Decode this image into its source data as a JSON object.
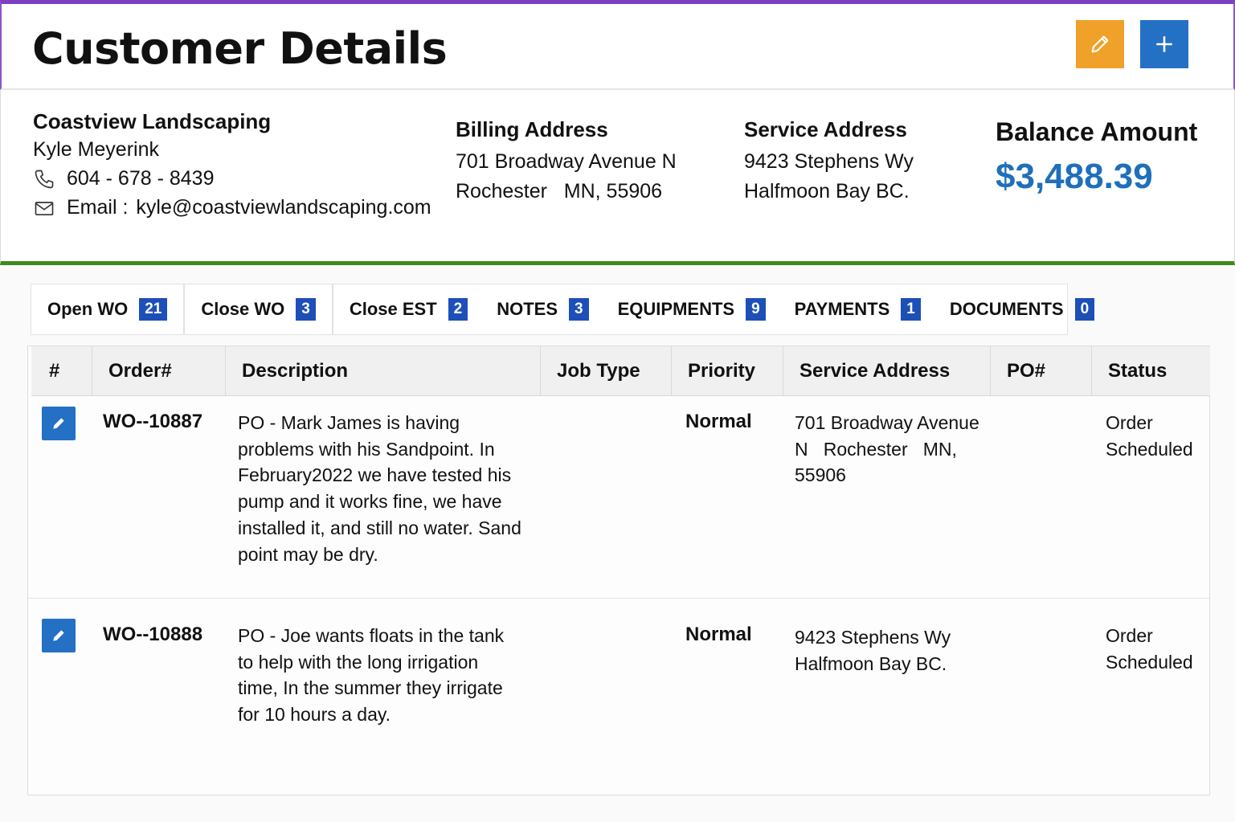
{
  "header": {
    "title": "Customer Details",
    "edit_icon": "pencil-icon",
    "add_icon": "plus-icon",
    "edit_color": "#f0a12a",
    "add_color": "#2470c4"
  },
  "customer": {
    "company": "Coastview Landscaping",
    "contact": "Kyle Meyerink",
    "phone": "604 - 678 - 8439",
    "email_label": "Email :",
    "email": "kyle@coastviewlandscaping.com"
  },
  "billing": {
    "label": "Billing Address",
    "line1": "701 Broadway Avenue N",
    "line2": "Rochester   MN, 55906"
  },
  "service": {
    "label": "Service Address",
    "line1": "9423 Stephens Wy",
    "line2": "Halfmoon Bay BC."
  },
  "balance": {
    "label": "Balance Amount",
    "amount": "$3,488.39",
    "color": "#1f6fba"
  },
  "tabs": [
    {
      "label": "Open WO",
      "count": "21"
    },
    {
      "label": "Close WO",
      "count": "3"
    },
    {
      "label": "Close EST",
      "count": "2"
    },
    {
      "label": "NOTES",
      "count": "3"
    },
    {
      "label": "EQUIPMENTS",
      "count": "9"
    },
    {
      "label": "PAYMENTS",
      "count": "1"
    },
    {
      "label": "DOCUMENTS",
      "count": "0"
    }
  ],
  "table": {
    "columns": [
      "#",
      "Order#",
      "Description",
      "Job Type",
      "Priority",
      "Service Address",
      "PO#",
      "Status"
    ],
    "rows": [
      {
        "order": "WO--10887",
        "description": "PO - Mark James is having problems with his Sandpoint. In February2022 we have tested his pump and it works fine, we have installed it, and still no water. Sand point may be dry.",
        "job_type": "",
        "priority": "Normal",
        "service_address": "701 Broadway Avenue N   Rochester   MN, 55906",
        "po": "",
        "status": "Order Scheduled"
      },
      {
        "order": "WO--10888",
        "description": "PO - Joe wants floats in the tank to help with the long irrigation time, In the summer they irrigate for 10 hours a day.",
        "job_type": "",
        "priority": "Normal",
        "service_address": "9423 Stephens Wy Halfmoon Bay BC.",
        "po": "",
        "status": "Order Scheduled"
      }
    ]
  },
  "colors": {
    "header_accent": "#7b3fc2",
    "divider": "#3e8a1e",
    "badge": "#1d4fb8"
  }
}
